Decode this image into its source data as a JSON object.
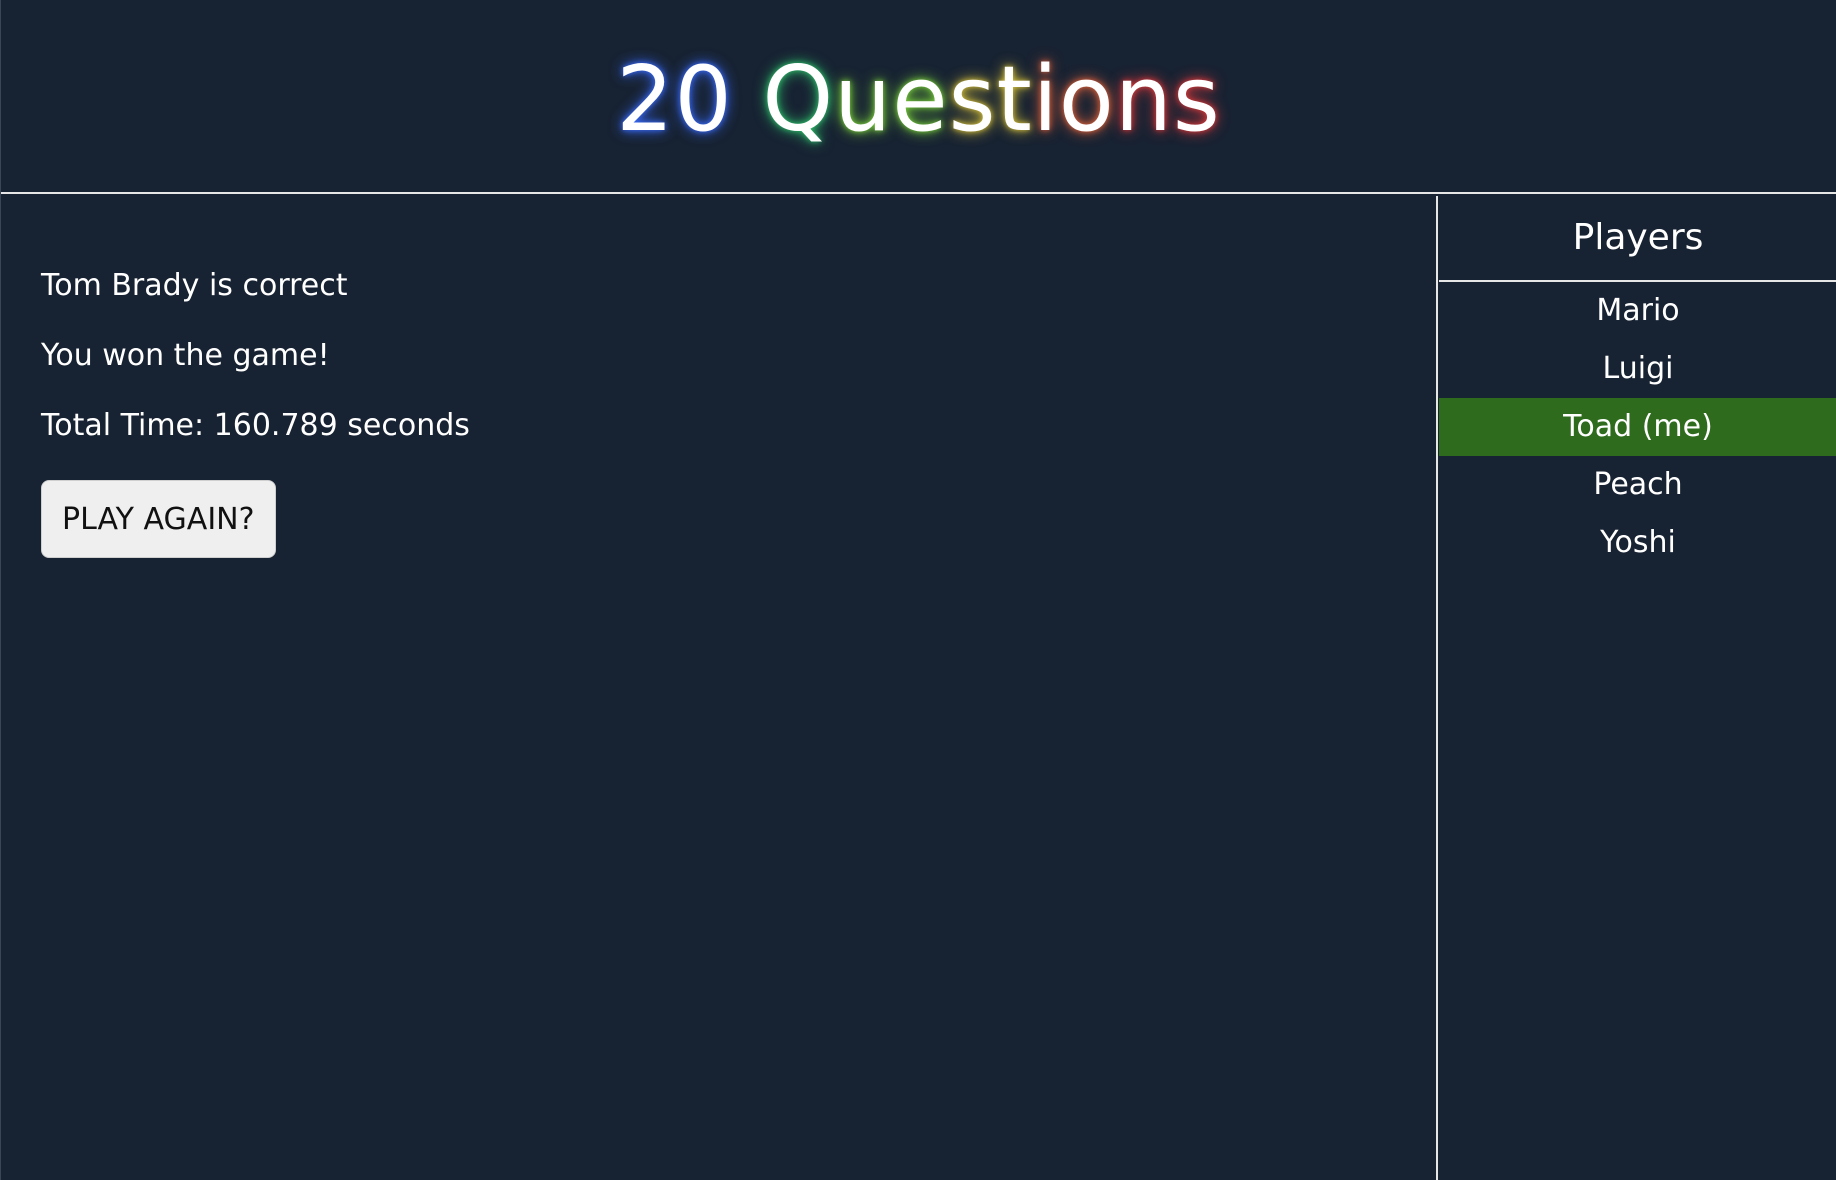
{
  "app": {
    "title_parts": [
      "20",
      " ",
      "Q",
      "ue",
      "st",
      "io",
      "ns"
    ],
    "colors": {
      "background": "#172232",
      "divider": "#e6e6e6",
      "current_player_highlight": "#2e6b1c",
      "button_bg": "#efefef",
      "glow_gradient": [
        "#3a6cff",
        "#37c6e0",
        "#2fbf6b",
        "#7ad13a",
        "#d8c23a",
        "#e0623a",
        "#e03a3a"
      ]
    }
  },
  "main": {
    "messages": [
      "Tom Brady is correct",
      "You won the game!",
      "Total Time: 160.789 seconds"
    ],
    "play_again_label": "PLAY AGAIN?"
  },
  "sidebar": {
    "title": "Players",
    "players": [
      {
        "name": "Mario",
        "is_me": false
      },
      {
        "name": "Luigi",
        "is_me": false
      },
      {
        "name": "Toad (me)",
        "is_me": true
      },
      {
        "name": "Peach",
        "is_me": false
      },
      {
        "name": "Yoshi",
        "is_me": false
      }
    ]
  }
}
